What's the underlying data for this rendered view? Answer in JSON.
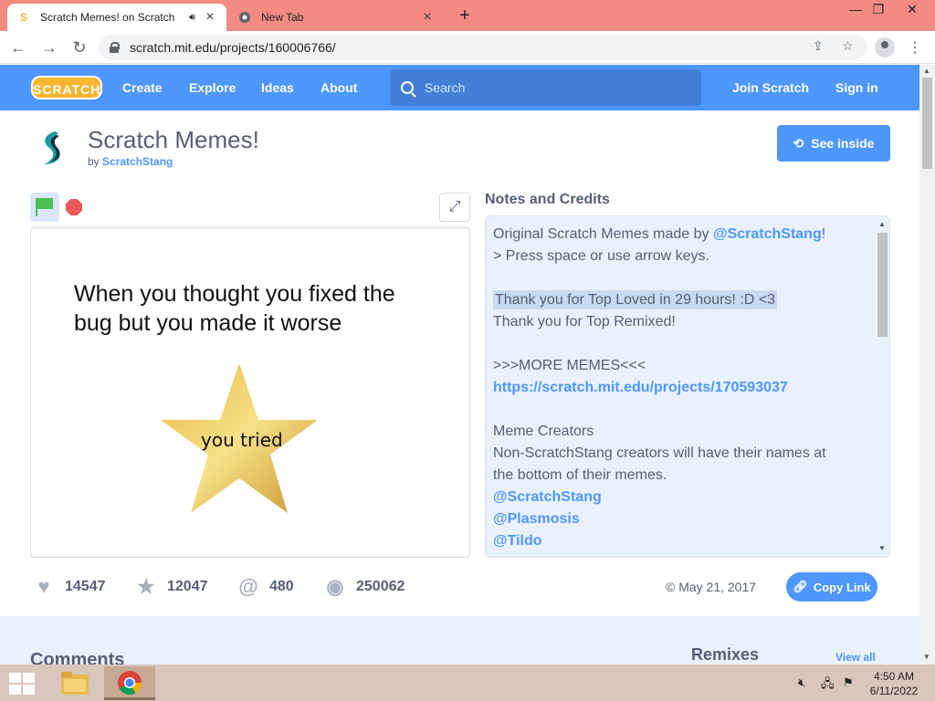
{
  "browser": {
    "tabs": [
      {
        "title": "Scratch Memes! on Scratch",
        "active": true
      },
      {
        "title": "New Tab",
        "active": false
      }
    ],
    "url": "scratch.mit.edu/projects/160006766/"
  },
  "nav": {
    "logo": "SCRATCH",
    "links": [
      "Create",
      "Explore",
      "Ideas",
      "About"
    ],
    "search_placeholder": "Search",
    "join": "Join Scratch",
    "signin": "Sign in"
  },
  "project": {
    "title": "Scratch Memes!",
    "by_label": "by",
    "author": "ScratchStang",
    "see_inside": "See inside",
    "stage_text": "When you thought you fixed the bug but you made it worse",
    "stage_star_label": "you tried"
  },
  "notes": {
    "heading": "Notes and Credits",
    "lines": {
      "l1_text": "Original Scratch Memes made by ",
      "l1_link": "@ScratchStang",
      "l1_end": "!",
      "l2": "> Press space or use arrow keys.",
      "l4": "Thank you for Top Loved in 29 hours! :D <3",
      "l5": "Thank you for Top Remixed!",
      "l7": ">>>MORE MEMES<<<",
      "l8_link": "https://scratch.mit.edu/projects/170593037",
      "l10": "Meme Creators",
      "l11": "Non-ScratchStang creators will have their names at",
      "l12": "the bottom of their memes.",
      "l13_link": "@ScratchStang",
      "l14_link": "@Plasmosis",
      "l15_link": "@Tildo"
    }
  },
  "stats": {
    "loves": "14547",
    "favorites": "12047",
    "remixes": "480",
    "views": "250062",
    "date": "© May 21, 2017",
    "copy_link": "Copy Link"
  },
  "lower": {
    "comments": "Comments",
    "remixes": "Remixes",
    "view_all": "View all"
  },
  "taskbar": {
    "time": "4:50 AM",
    "date": "6/11/2022"
  },
  "colors": {
    "scratch_blue": "#4d97ff",
    "tab_bar": "#f28b82",
    "notes_bg": "#e9f1fc",
    "taskbar": "#d9c7bd"
  }
}
